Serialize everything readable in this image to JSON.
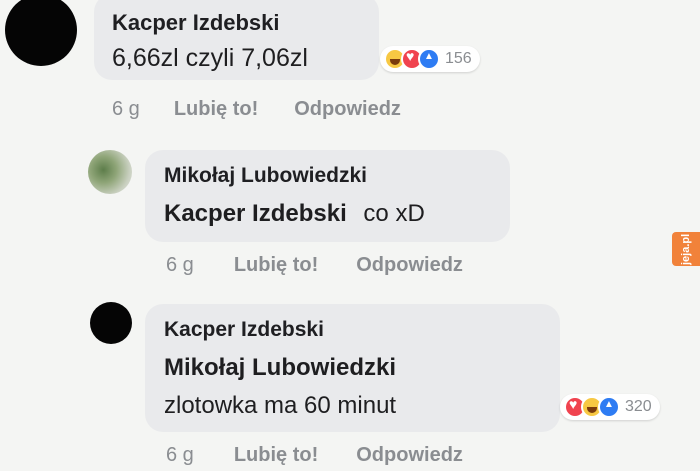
{
  "comments": [
    {
      "author": "Kacper Izdebski",
      "text": "6,66zl czyli 7,06zl",
      "reaction_count": "156",
      "reactions": [
        "haha-icon",
        "love-icon",
        "like-icon"
      ],
      "time": "6 g",
      "like_label": "Lubię to!",
      "reply_label": "Odpowiedz"
    },
    {
      "author": "Mikołaj Lubowiedzki",
      "mention": "Kacper Izdebski",
      "text": "co xD",
      "time": "6 g",
      "like_label": "Lubię to!",
      "reply_label": "Odpowiedz"
    },
    {
      "author": "Kacper Izdebski",
      "mention": "Mikołaj Lubowiedzki",
      "text": "zlotowka ma 60 minut",
      "reaction_count": "320",
      "reactions": [
        "love-icon",
        "haha-icon",
        "like-icon"
      ],
      "time": "6 g",
      "like_label": "Lubię to!",
      "reply_label": "Odpowiedz"
    }
  ],
  "watermark": "jeja.pl"
}
